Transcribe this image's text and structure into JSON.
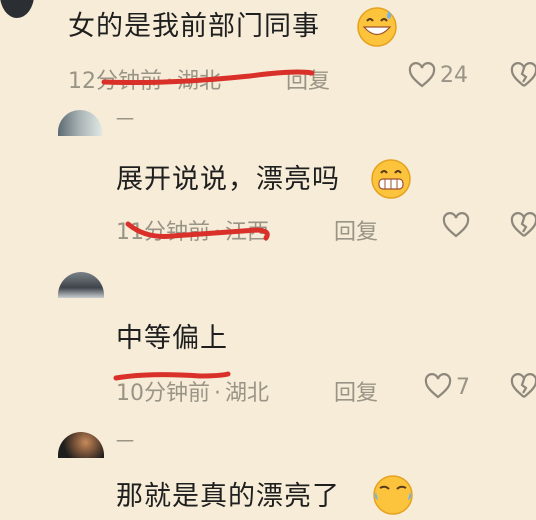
{
  "comments": [
    {
      "text": "女的是我前部门同事",
      "time": "12分钟前",
      "location": "湖北",
      "reply_label": "回复",
      "like_count": "24",
      "emoji": "grinning-sweat-emoji"
    },
    {
      "username": "一",
      "text": "展开说说，漂亮吗",
      "time": "11分钟前",
      "location": "江西",
      "reply_label": "回复",
      "like_count": "",
      "emoji": "grinning-emoji"
    },
    {
      "username": "",
      "text": "中等偏上",
      "time": "10分钟前",
      "location": "湖北",
      "reply_label": "回复",
      "like_count": "7"
    },
    {
      "username": "一",
      "text": "那就是真的漂亮了",
      "emoji": "laughing-tears-emoji"
    }
  ],
  "colors": {
    "background": "#f6ecd7",
    "meta_gray": "#9a9487",
    "annotation_red": "#d9302a"
  }
}
